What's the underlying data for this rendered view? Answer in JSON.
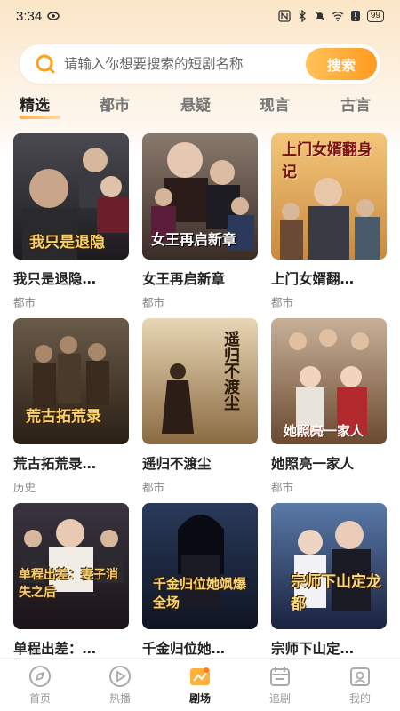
{
  "status_bar": {
    "time": "3:34",
    "battery": "99"
  },
  "search": {
    "placeholder": "请输入你想要搜索的短剧名称",
    "button_label": "搜索"
  },
  "tabs": [
    {
      "label": "精选",
      "active": true
    },
    {
      "label": "都市",
      "active": false
    },
    {
      "label": "悬疑",
      "active": false
    },
    {
      "label": "现言",
      "active": false
    },
    {
      "label": "古言",
      "active": false
    }
  ],
  "dramas": [
    {
      "title": "我只是退隐…",
      "genre": "都市",
      "poster_text": "我只是退隐"
    },
    {
      "title": "女王再启新章",
      "genre": "都市",
      "poster_text": "女王再启新章"
    },
    {
      "title": "上门女婿翻…",
      "genre": "都市",
      "poster_text": "上门女婿翻身记"
    },
    {
      "title": "荒古拓荒录…",
      "genre": "历史",
      "poster_text": "荒古拓荒录"
    },
    {
      "title": "遥归不渡尘",
      "genre": "都市",
      "poster_text": "遥归不渡尘"
    },
    {
      "title": "她照亮一家人",
      "genre": "都市",
      "poster_text": "她照亮一家人"
    },
    {
      "title": "单程出差：…",
      "genre": "",
      "poster_text": "单程出差：妻子消失之后"
    },
    {
      "title": "千金归位她…",
      "genre": "",
      "poster_text": "千金归位她飒爆全场"
    },
    {
      "title": "宗师下山定…",
      "genre": "",
      "poster_text": "宗师下山定龙都"
    }
  ],
  "bottom_nav": [
    {
      "label": "首页",
      "icon": "compass-icon",
      "active": false
    },
    {
      "label": "热播",
      "icon": "play-icon",
      "active": false
    },
    {
      "label": "剧场",
      "icon": "theater-icon",
      "active": true
    },
    {
      "label": "追剧",
      "icon": "calendar-icon",
      "active": false
    },
    {
      "label": "我的",
      "icon": "profile-icon",
      "active": false
    }
  ],
  "colors": {
    "accent": "#ff9a1e",
    "accent_light": "#ffc25a",
    "text": "#222222",
    "muted": "#888888"
  }
}
